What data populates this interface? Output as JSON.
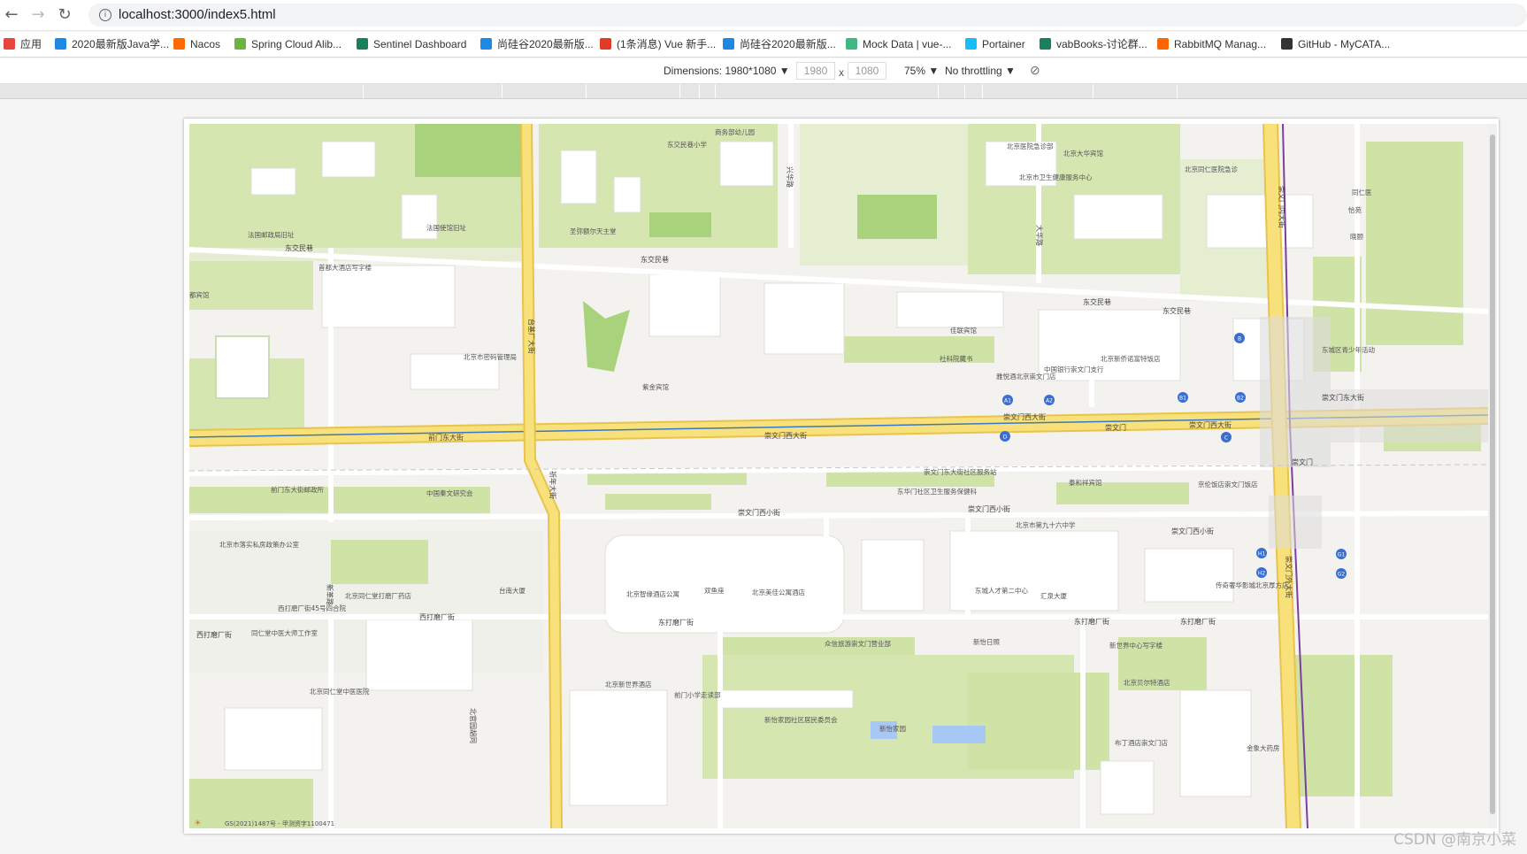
{
  "browser": {
    "url": "localhost:3000/index5.html",
    "bookmarks": [
      {
        "label": "应用",
        "icon": "apps-grid-icon",
        "color": "#e8453c"
      },
      {
        "label": "2020最新版Java学...",
        "icon": "bilibili-icon",
        "color": "#1e88e5"
      },
      {
        "label": "Nacos",
        "icon": "nacos-icon",
        "color": "#ff6a00"
      },
      {
        "label": "Spring Cloud Alib...",
        "icon": "spring-icon",
        "color": "#6db33f"
      },
      {
        "label": "Sentinel Dashboard",
        "icon": "sentinel-icon",
        "color": "#1b7f5a"
      },
      {
        "label": "尚硅谷2020最新版...",
        "icon": "bilibili-icon",
        "color": "#1e88e5"
      },
      {
        "label": "(1条消息) Vue 新手...",
        "icon": "csdn-icon",
        "color": "#e03b24"
      },
      {
        "label": "尚硅谷2020最新版...",
        "icon": "bilibili-icon",
        "color": "#1e88e5"
      },
      {
        "label": "Mock Data | vue-...",
        "icon": "vue-icon",
        "color": "#41b883"
      },
      {
        "label": "Portainer",
        "icon": "portainer-icon",
        "color": "#13bef9"
      },
      {
        "label": "vabBooks-讨论群...",
        "icon": "vab-icon",
        "color": "#1b7f5a"
      },
      {
        "label": "RabbitMQ Manag...",
        "icon": "rabbitmq-icon",
        "color": "#ff6600"
      },
      {
        "label": "GitHub - MyCATA...",
        "icon": "github-icon",
        "color": "#333333"
      }
    ]
  },
  "devtools": {
    "dimensions_label": "Dimensions: 1980*1080 ▼",
    "width": "1980",
    "height": "1080",
    "x": "x",
    "zoom": "75% ▼",
    "throttle": "No throttling ▼"
  },
  "map": {
    "streets": [
      "东交民巷",
      "东交民巷",
      "东交民巷",
      "东交民巷",
      "台基厂大街",
      "前门东大街",
      "崇文门西大街",
      "崇文门西大街",
      "崇文门西大街",
      "崇文门东大街",
      "崇文门西小街",
      "崇文门西小街",
      "崇文门西小街",
      "西打磨厂街",
      "西打磨厂街",
      "东打磨厂街",
      "东打磨厂街",
      "东打磨厂街",
      "祈年大街",
      "新革路",
      "北官园胡同",
      "崇文门外大街",
      "崇文门内大街",
      "兴华路",
      "大华路",
      "崇文门",
      "崇文门"
    ],
    "pois": [
      "法国邮政局旧址",
      "法国使馆旧址",
      "首都大酒店写字楼",
      "都宾馆",
      "北京市密码管理局",
      "东交民巷小学",
      "商务部幼儿园",
      "圣弥额尔天主堂",
      "紫金宾馆",
      "北京医院急诊部",
      "北京大华宾馆",
      "北京市卫生健康服务中心",
      "北京同仁医院急诊",
      "同仁医",
      "恰苑",
      "晓颐",
      "佳联宾馆",
      "社科院藏书",
      "雅悦酒北京崇文门店",
      "中国银行崇文门支行",
      "北京新侨诺富特饭店",
      "东城区青少年活动",
      "前门东大街邮政所",
      "中国秦文研究会",
      "崇文门东大街社区服务站",
      "东华门社区卫生服务保健科",
      "泰和祥宾馆",
      "京伦饭店崇文门饭店",
      "北京市第九十六中学",
      "北京市落实私房政策办公室",
      "北京同仁堂打磨厂药店",
      "西打磨厂街45号四合院",
      "同仁堂中医大师工作室",
      "台南大厦",
      "北京智缘酒店公寓",
      "双鱼座",
      "北京美佳公寓酒店",
      "东城人才第二中心",
      "汇泉大厦",
      "传奇奢华影城北京厚方店",
      "新世界中心写字楼",
      "北京贝尔特酒店",
      "新怡家园社区居民委员会",
      "众信旅游崇文门营业部",
      "北京同仁堂中医医院",
      "北京新世界酒店",
      "前门小学走读部",
      "新怡日照",
      "新怡家园",
      "布丁酒店崇文门店",
      "金象大药房"
    ],
    "transit_badges": [
      "A1",
      "A2",
      "B1",
      "B2",
      "D",
      "C",
      "B",
      "H1",
      "H2",
      "G1",
      "G2"
    ],
    "footer_text": "GS(2021)1487号 - 甲测资字1100471",
    "colors": {
      "major_road": "#f6dc74",
      "road": "#ffffff",
      "green": "#cfe3a6",
      "block": "#f3f2ee",
      "park": "#a9d27c",
      "metro": "#7b3f9f",
      "water": "#a7c7f5"
    }
  },
  "watermark": "CSDN @南京小菜"
}
